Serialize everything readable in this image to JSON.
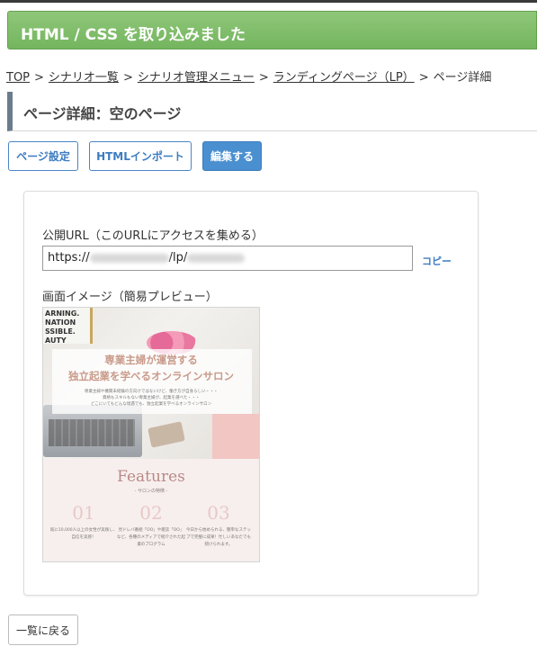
{
  "banner": {
    "message": "HTML / CSS を取り込みました"
  },
  "breadcrumb": {
    "items": [
      "TOP",
      "シナリオ一覧",
      "シナリオ管理メニュー",
      "ランディングページ（LP）"
    ],
    "current": "ページ詳細",
    "separator": ">"
  },
  "page": {
    "title": "ページ詳細：空のページ"
  },
  "toolbar": {
    "page_settings": "ページ設定",
    "html_import": "HTMLインポート",
    "edit": "編集する"
  },
  "card": {
    "url_label": "公開URL（このURLにアクセスを集める）",
    "url_prefix": "https://",
    "url_middle": "/lp/",
    "copy": "コピー",
    "preview_label": "画面イメージ（簡易プレビュー）"
  },
  "preview": {
    "poster_text": "ARNING.\nNATION\nSSIBLE.\nAUTY",
    "hero_line1": "専業主婦が運営する",
    "hero_line2": "独立起業を学べるオンラインサロン",
    "hero_small1": "専業主婦や機関未経験の方向けではないけど、働き方が自身らしい・・・",
    "hero_small2": "資格もスキルもない専業主婦が、起業を選べた・・・",
    "hero_small3": "どこにいてもどんな境遇でも、独立起業を学べるオンラインサロン",
    "features_title": "Features",
    "features_sub": "- サロンの特徴 -",
    "features": [
      {
        "num": "01",
        "text": "既に10,000人以上の女性が実践し、自信を実感！"
      },
      {
        "num": "02",
        "text": "見ドレバ番組「OO」や雑誌「OO」など、各種のメディアで紹介された起業のプログラム"
      },
      {
        "num": "03",
        "text": "今日から始められる、簡単なステップで完璧に成果！忙しいあなたでも続けられます。"
      }
    ]
  },
  "footer": {
    "back": "一覧に戻る"
  },
  "colors": {
    "banner": "#74b55f",
    "accent": "#4a8fd0",
    "link": "#3d7cc0"
  }
}
